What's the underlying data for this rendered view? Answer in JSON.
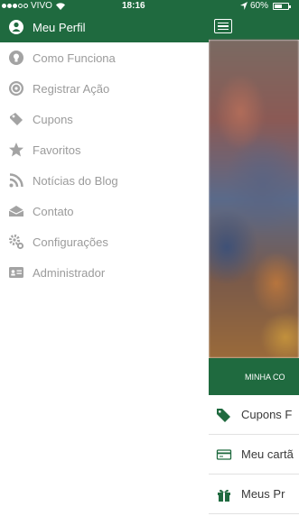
{
  "status_bar": {
    "carrier": "VIVO",
    "time": "18:16",
    "battery": "60%",
    "battery_level": 0.6
  },
  "colors": {
    "brand_green": "#1f6a3f",
    "menu_text": "#9b9b9b",
    "menu_icon": "#a3a3a3"
  },
  "menu": {
    "items": [
      {
        "label": "Meu Perfil",
        "icon": "user-icon",
        "active": true
      },
      {
        "label": "Como Funciona",
        "icon": "lightbulb-icon",
        "active": false
      },
      {
        "label": "Registrar Ação",
        "icon": "register-action-icon",
        "active": false
      },
      {
        "label": "Cupons",
        "icon": "coupon-tag-icon",
        "active": false
      },
      {
        "label": "Favoritos",
        "icon": "star-icon",
        "active": false
      },
      {
        "label": "Notícias do Blog",
        "icon": "rss-icon",
        "active": false
      },
      {
        "label": "Contato",
        "icon": "envelope-icon",
        "active": false
      },
      {
        "label": "Configurações",
        "icon": "gears-icon",
        "active": false
      },
      {
        "label": "Administrador",
        "icon": "id-card-icon",
        "active": false
      }
    ]
  },
  "main": {
    "menu_button": "hamburger-icon",
    "banner_text": "MINHA CO",
    "rows": [
      {
        "label": "Cupons F",
        "icon": "tag-icon"
      },
      {
        "label": "Meu cartã",
        "icon": "card-icon"
      },
      {
        "label": "Meus Pr",
        "icon": "gift-icon"
      }
    ]
  }
}
